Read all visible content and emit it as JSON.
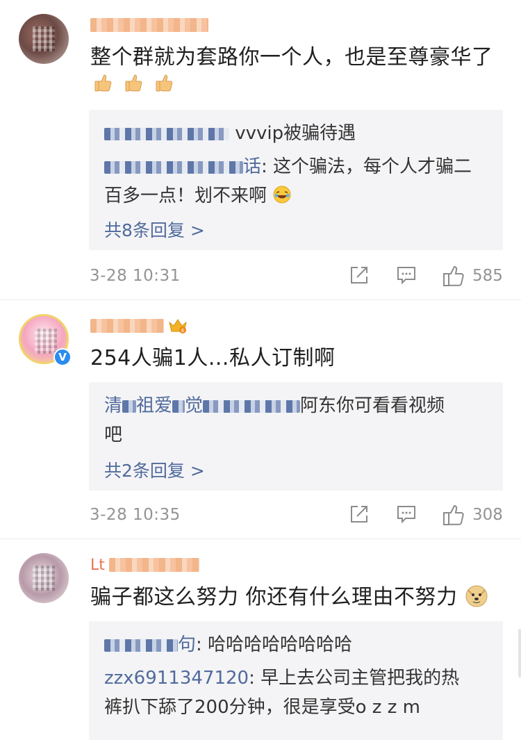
{
  "comments": [
    {
      "main_text": "整个群就为套路你一个人，也是至尊豪华了",
      "emoji_thumb_count": 3,
      "replies": [
        {
          "name_visible": "vvvip被骗待遇",
          "text": ""
        },
        {
          "name_visible": "话",
          "text": ": 这个骗法，每个人才骗二",
          "text_cont": "百多一点！划不来啊"
        }
      ],
      "more_label": "共8条回复 >",
      "timestamp": "3-28 10:31",
      "like_count": "585"
    },
    {
      "main_text": "254人骗1人...私人订制啊",
      "verified": true,
      "replies": [
        {
          "name_prefix": "清",
          "name_mid": "祖爱",
          "name_mid2": "觉",
          "text": "阿东你可看看视频",
          "text_cont": "吧"
        }
      ],
      "more_label": "共2条回复 >",
      "timestamp": "3-28 10:35",
      "like_count": "308"
    },
    {
      "username_prefix": "Lt",
      "main_text": "骗子都这么努力 你还有什么理由不努力",
      "replies": [
        {
          "name_suffix": "句",
          "text": ": 哈哈哈哈哈哈哈哈"
        },
        {
          "name": "zzx6911347120",
          "text": ": 早上去公司主管把我的热",
          "text_cont": "裤扒下舔了200分钟，很是享受o z z m"
        }
      ]
    }
  ],
  "icons": {
    "share": "share-icon",
    "comment": "comment-icon",
    "like": "like-icon",
    "crown": "crown-icon",
    "verified": "verified-badge-icon"
  },
  "colors": {
    "username": "#eb7350",
    "reply_name": "#506a9c",
    "meta": "#939393",
    "reply_bg": "#f4f4f6",
    "verified": "#2a8cf0"
  }
}
